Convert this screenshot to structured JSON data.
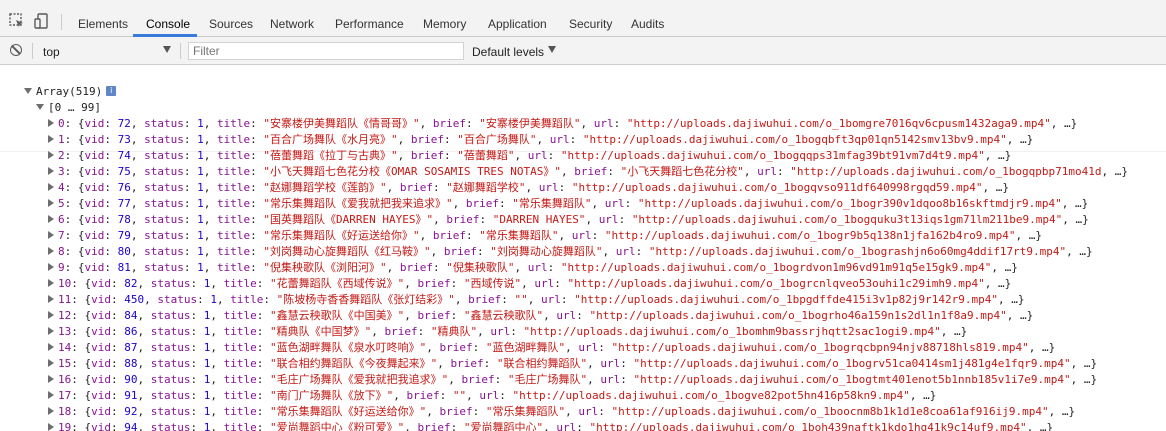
{
  "tabs": [
    {
      "label": "Elements",
      "active": false
    },
    {
      "label": "Console",
      "active": true
    },
    {
      "label": "Sources",
      "active": false
    },
    {
      "label": "Network",
      "active": false
    },
    {
      "label": "Performance",
      "active": false
    },
    {
      "label": "Memory",
      "active": false
    },
    {
      "label": "Application",
      "active": false
    },
    {
      "label": "Security",
      "active": false
    },
    {
      "label": "Audits",
      "active": false
    }
  ],
  "toolbar": {
    "context": "top",
    "filter_placeholder": "Filter",
    "filter_value": "",
    "levels_label": "Default levels"
  },
  "console": {
    "array_header": "Array(519)",
    "group_label": "[0 … 99]",
    "rows": [
      {
        "idx": "0",
        "vid": "72",
        "status": "1",
        "title": "\"安寨楼伊美舞蹈队《情哥哥》\"",
        "brief": "\"安寨楼伊美舞蹈队\"",
        "url": "\"http://uploads.dajiwuhui.com/o_1bomgre7016qv6cpusm1432aga9.mp4\""
      },
      {
        "idx": "1",
        "vid": "73",
        "status": "1",
        "title": "\"百合广场舞队《水月亮》\"",
        "brief": "\"百合广场舞队\"",
        "url": "\"http://uploads.dajiwuhui.com/o_1bogqbft3qp01qn5142smv13bv9.mp4\""
      },
      {
        "idx": "2",
        "vid": "74",
        "status": "1",
        "title": "\"蓓蕾舞蹈《拉丁与古典》\"",
        "brief": "\"蓓蕾舞蹈\"",
        "url": "\"http://uploads.dajiwuhui.com/o_1bogqqps31mfag39bt91vm7d4t9.mp4\""
      },
      {
        "idx": "3",
        "vid": "75",
        "status": "1",
        "title": "\"小飞天舞蹈七色花分校《OMAR SOSAMIS TRES NOTAS》\"",
        "brief": "\"小飞天舞蹈七色花分校\"",
        "url": "\"http://uploads.dajiwuhui.com/o_1bogqpbp71mo41d"
      },
      {
        "idx": "4",
        "vid": "76",
        "status": "1",
        "title": "\"赵娜舞蹈学校《莲韵》\"",
        "brief": "\"赵娜舞蹈学校\"",
        "url": "\"http://uploads.dajiwuhui.com/o_1bogqvso911df640998rgqd59.mp4\""
      },
      {
        "idx": "5",
        "vid": "77",
        "status": "1",
        "title": "\"常乐集舞蹈队《爱我就把我来追求》\"",
        "brief": "\"常乐集舞蹈队\"",
        "url": "\"http://uploads.dajiwuhui.com/o_1bogr390v1dqoo8b16skftmdjr9.mp4\""
      },
      {
        "idx": "6",
        "vid": "78",
        "status": "1",
        "title": "\"国英舞蹈队《DARREN HAYES》\"",
        "brief": "\"DARREN HAYES\"",
        "url": "\"http://uploads.dajiwuhui.com/o_1bogquku3t13iqs1gm71lm211be9.mp4\""
      },
      {
        "idx": "7",
        "vid": "79",
        "status": "1",
        "title": "\"常乐集舞蹈队《好运送给你》\"",
        "brief": "\"常乐集舞蹈队\"",
        "url": "\"http://uploads.dajiwuhui.com/o_1bogr9b5q138n1jfa162b4ro9.mp4\""
      },
      {
        "idx": "8",
        "vid": "80",
        "status": "1",
        "title": "\"刘岗舞动心旋舞蹈队《红马鞍》\"",
        "brief": "\"刘岗舞动心旋舞蹈队\"",
        "url": "\"http://uploads.dajiwuhui.com/o_1bograshjn6o60mg4ddif17rt9.mp4\""
      },
      {
        "idx": "9",
        "vid": "81",
        "status": "1",
        "title": "\"倪集秧歌队《浏阳河》\"",
        "brief": "\"倪集秧歌队\"",
        "url": "\"http://uploads.dajiwuhui.com/o_1bogrdvon1m96vd91m91q5e15gk9.mp4\""
      },
      {
        "idx": "10",
        "vid": "82",
        "status": "1",
        "title": "\"花蕾舞蹈队《西域传说》\"",
        "brief": "\"西域传说\"",
        "url": "\"http://uploads.dajiwuhui.com/o_1bogrcnlqveo53ouhi1c29imh9.mp4\""
      },
      {
        "idx": "11",
        "vid": "450",
        "status": "1",
        "title": "\"陈坡杨寺香香舞蹈队《张灯结彩》\"",
        "brief": "\"\"",
        "url": "\"http://uploads.dajiwuhui.com/o_1bpgdffde415i3v1p82j9r142r9.mp4\""
      },
      {
        "idx": "12",
        "vid": "84",
        "status": "1",
        "title": "\"鑫慧云秧歌队《中国美》\"",
        "brief": "\"鑫慧云秧歌队\"",
        "url": "\"http://uploads.dajiwuhui.com/o_1bogrho46a159n1s2dl1n1f8a9.mp4\""
      },
      {
        "idx": "13",
        "vid": "86",
        "status": "1",
        "title": "\"精典队《中国梦》\"",
        "brief": "\"精典队\"",
        "url": "\"http://uploads.dajiwuhui.com/o_1bomhm9bassrjhqtt2sac1ogi9.mp4\""
      },
      {
        "idx": "14",
        "vid": "87",
        "status": "1",
        "title": "\"蓝色湖畔舞队《泉水叮咚响》\"",
        "brief": "\"蓝色湖畔舞队\"",
        "url": "\"http://uploads.dajiwuhui.com/o_1bogrqcbpn94njv88718hls819.mp4\""
      },
      {
        "idx": "15",
        "vid": "88",
        "status": "1",
        "title": "\"联合相约舞蹈队《今夜舞起来》\"",
        "brief": "\"联合相约舞蹈队\"",
        "url": "\"http://uploads.dajiwuhui.com/o_1bogrv51ca0414sm1j481g4e1fqr9.mp4\""
      },
      {
        "idx": "16",
        "vid": "90",
        "status": "1",
        "title": "\"毛庄广场舞队《爱我就把我追求》\"",
        "brief": "\"毛庄广场舞队\"",
        "url": "\"http://uploads.dajiwuhui.com/o_1bogtmt401enot5b1nnb185v1i7e9.mp4\""
      },
      {
        "idx": "17",
        "vid": "91",
        "status": "1",
        "title": "\"南门广场舞队《放下》\"",
        "brief": "\"\"",
        "url": "\"http://uploads.dajiwuhui.com/o_1bogve82pot5hn416p58kn9.mp4\""
      },
      {
        "idx": "18",
        "vid": "92",
        "status": "1",
        "title": "\"常乐集舞蹈队《好运送给你》\"",
        "brief": "\"常乐集舞蹈队\"",
        "url": "\"http://uploads.dajiwuhui.com/o_1boocnm8b1k1d1e8coa61af916ij9.mp4\""
      },
      {
        "idx": "19",
        "vid": "94",
        "status": "1",
        "title": "\"爱尚舞蹈中心《粉可爱》\"",
        "brief": "\"爱尚舞蹈中心\"",
        "url": "\"http://uploads.dajiwuhui.com/o_1boh439naftk1kdo1hg41k9c14uf9.mp4\""
      }
    ],
    "key_vid": "vid",
    "key_status": "status",
    "key_title": "title",
    "key_brief": "brief",
    "key_url": "url",
    "ellipsis": "…}"
  },
  "icons": {
    "inspect": "inspect-element-icon",
    "device": "device-toolbar-icon",
    "clear": "clear-console-icon",
    "info": "info-icon"
  },
  "colors": {
    "accent": "#3879d9",
    "index": "#881391",
    "number": "#1c00cf",
    "string": "#c41a16"
  }
}
